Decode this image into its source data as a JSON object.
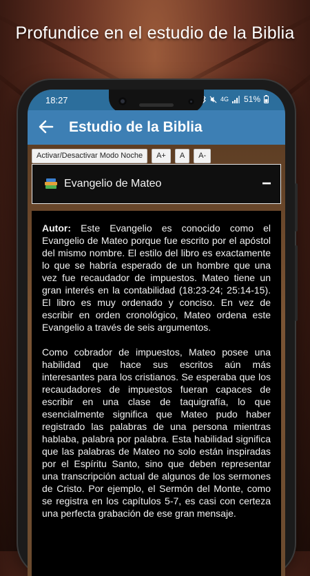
{
  "promo": {
    "title": "Profundice en el estudio de la Biblia"
  },
  "status": {
    "time": "18:27",
    "network": "4G",
    "battery": "51%"
  },
  "appbar": {
    "back_icon": "arrow-left-icon",
    "title": "Estudio de la Biblia"
  },
  "toolbar": {
    "night_mode_label": "Activar/Desactivar Modo Noche",
    "font_increase_label": "A+",
    "font_reset_label": "A",
    "font_decrease_label": "A-"
  },
  "chapter": {
    "icon": "books-icon",
    "title": "Evangelio de Mateo",
    "collapse_symbol": "−"
  },
  "content": {
    "author_label": "Autor:",
    "p1": "Este Evangelio es conocido como el Evangelio de Mateo porque fue escrito por el apóstol del mismo nombre. El estilo del libro es exactamente lo que se habría esperado de un hombre que una vez fue recaudador de impuestos. Mateo tiene un gran interés en la contabilidad (18:23-24; 25:14-15). El libro es muy ordenado y conciso. En vez de escribir en orden cronológico, Mateo ordena este Evangelio a través de seis argumentos.",
    "p2": "Como cobrador de impuestos, Mateo posee una habilidad que hace sus escritos aún más interesantes para los cristianos. Se esperaba que los recaudadores de impuestos fueran capaces de escribir en una clase de taquigrafía, lo que esencialmente significa que Mateo pudo haber registrado las palabras de una persona mientras hablaba, palabra por palabra. Esta habilidad significa que las palabras de Mateo no solo están inspiradas por el Espíritu Santo, sino que deben representar una transcripción actual de algunos de los sermones de Cristo. Por ejemplo, el Sermón del Monte, como se registra en los capítulos 5-7, es casi con certeza una perfecta grabación de ese gran mensaje."
  }
}
